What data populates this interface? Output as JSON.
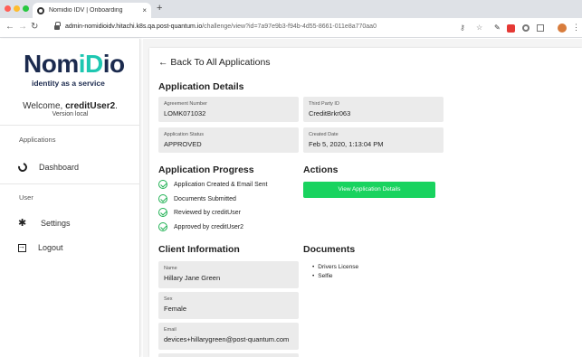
{
  "browser": {
    "tab_title": "Nomidio IDV | Onboarding",
    "tab_close": "×",
    "new_tab": "+",
    "url_host": "admin-nomidioidv.hitachi.k8s.qa.post-quantum.io",
    "url_path": "/challenge/view?id=7a97e9b3-f94b-4d55-8661-011e8a770aa0"
  },
  "sidebar": {
    "logo_text_a": "Nom",
    "logo_text_b": "i",
    "logo_text_c": "D",
    "logo_text_d": "io",
    "tagline": "identity as a service",
    "welcome_prefix": "Welcome, ",
    "welcome_user": "creditUser2",
    "welcome_suffix": ".",
    "version": "Version local",
    "section_applications": "Applications",
    "section_user": "User",
    "items": [
      {
        "label": "Dashboard",
        "icon": "dashboard-icon"
      },
      {
        "label": "Settings",
        "icon": "gear-icon"
      },
      {
        "label": "Logout",
        "icon": "logout-icon"
      }
    ]
  },
  "main": {
    "back_link": "← Back To All Applications",
    "details_heading": "Application Details",
    "fields": {
      "agreement_number": {
        "label": "Agreement Number",
        "value": "LOMK071032"
      },
      "third_party_id": {
        "label": "Third Party ID",
        "value": "CreditBrkr063"
      },
      "application_status": {
        "label": "Application Status",
        "value": "APPROVED"
      },
      "created_date": {
        "label": "Created Date",
        "value": "Feb 5, 2020, 1:13:04 PM"
      }
    },
    "progress_heading": "Application Progress",
    "progress_items": [
      "Application Created & Email Sent",
      "Documents Submitted",
      "Reviewed by creditUser",
      "Approved by creditUser2"
    ],
    "actions_heading": "Actions",
    "view_button_label": "View Application Details",
    "client_heading": "Client Information",
    "client_fields": {
      "name": {
        "label": "Name",
        "value": "Hillary Jane Green"
      },
      "sex": {
        "label": "Sex",
        "value": "Female"
      },
      "email": {
        "label": "Email",
        "value": "devices+hillarygreen@post-quantum.com"
      }
    },
    "documents_heading": "Documents",
    "documents": [
      "Drivers License",
      "Selfie"
    ]
  },
  "colors": {
    "accent_green": "#19d35f",
    "check_green": "#1fb152",
    "brand_navy": "#1b2a4e",
    "brand_teal": "#1ec7b1"
  }
}
